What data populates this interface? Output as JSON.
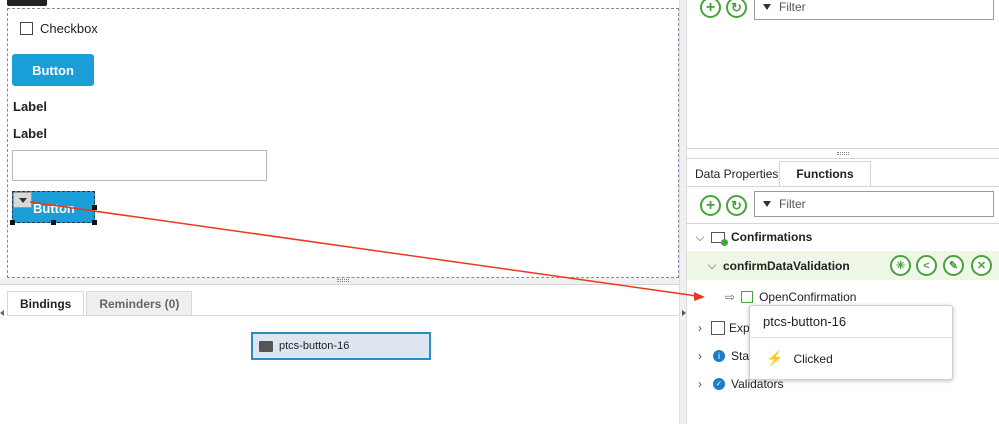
{
  "canvas": {
    "checkbox_label": "Checkbox",
    "button1_label": "Button",
    "label1": "Label",
    "label2": "Label",
    "textbox_value": "",
    "selected_button_label": "Button"
  },
  "bottom": {
    "tabs": [
      {
        "label": "Bindings",
        "active": true
      },
      {
        "label": "Reminders (0)",
        "active": false
      }
    ],
    "binding_node_label": "ptcs-button-16"
  },
  "right": {
    "top_filter_placeholder": "Filter",
    "tabs": [
      {
        "label": "Data Properties",
        "active": false
      },
      {
        "label": "Functions",
        "active": true
      }
    ],
    "filter_placeholder": "Filter",
    "tree": {
      "confirmations": "Confirmations",
      "confirm_validation": "confirmDataValidation",
      "open_confirmation": "OpenConfirmation",
      "expressions": "Exp",
      "status": "Sta",
      "validators": "Validators"
    }
  },
  "popup": {
    "title": "ptcs-button-16",
    "event": "Clicked"
  },
  "colors": {
    "accent_blue": "#1a9ed8",
    "green": "#48a33a",
    "arrow_red": "#e8391d",
    "highlight_row": "#eef7e6"
  }
}
